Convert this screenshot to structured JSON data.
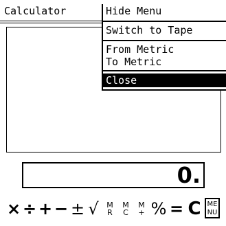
{
  "app": {
    "title": "Calculator"
  },
  "menu": {
    "items": [
      {
        "label": "Hide Menu"
      },
      {
        "label": "Switch to Tape"
      },
      {
        "label": "From Metric"
      },
      {
        "label": "To Metric"
      },
      {
        "label": "Close"
      }
    ],
    "selected": "Close"
  },
  "display": {
    "value": "0."
  },
  "keypad": {
    "multiply": "×",
    "divide": "÷",
    "plus": "+",
    "minus": "−",
    "plus_minus": "±",
    "sqrt": "√",
    "mr": {
      "top": "M",
      "bottom": "R"
    },
    "mc": {
      "top": "M",
      "bottom": "C"
    },
    "mplus": {
      "top": "M",
      "bottom": "+"
    },
    "percent": "%",
    "equals": "=",
    "clear": "C",
    "menu": {
      "top": "ME",
      "bottom": "NU"
    }
  }
}
